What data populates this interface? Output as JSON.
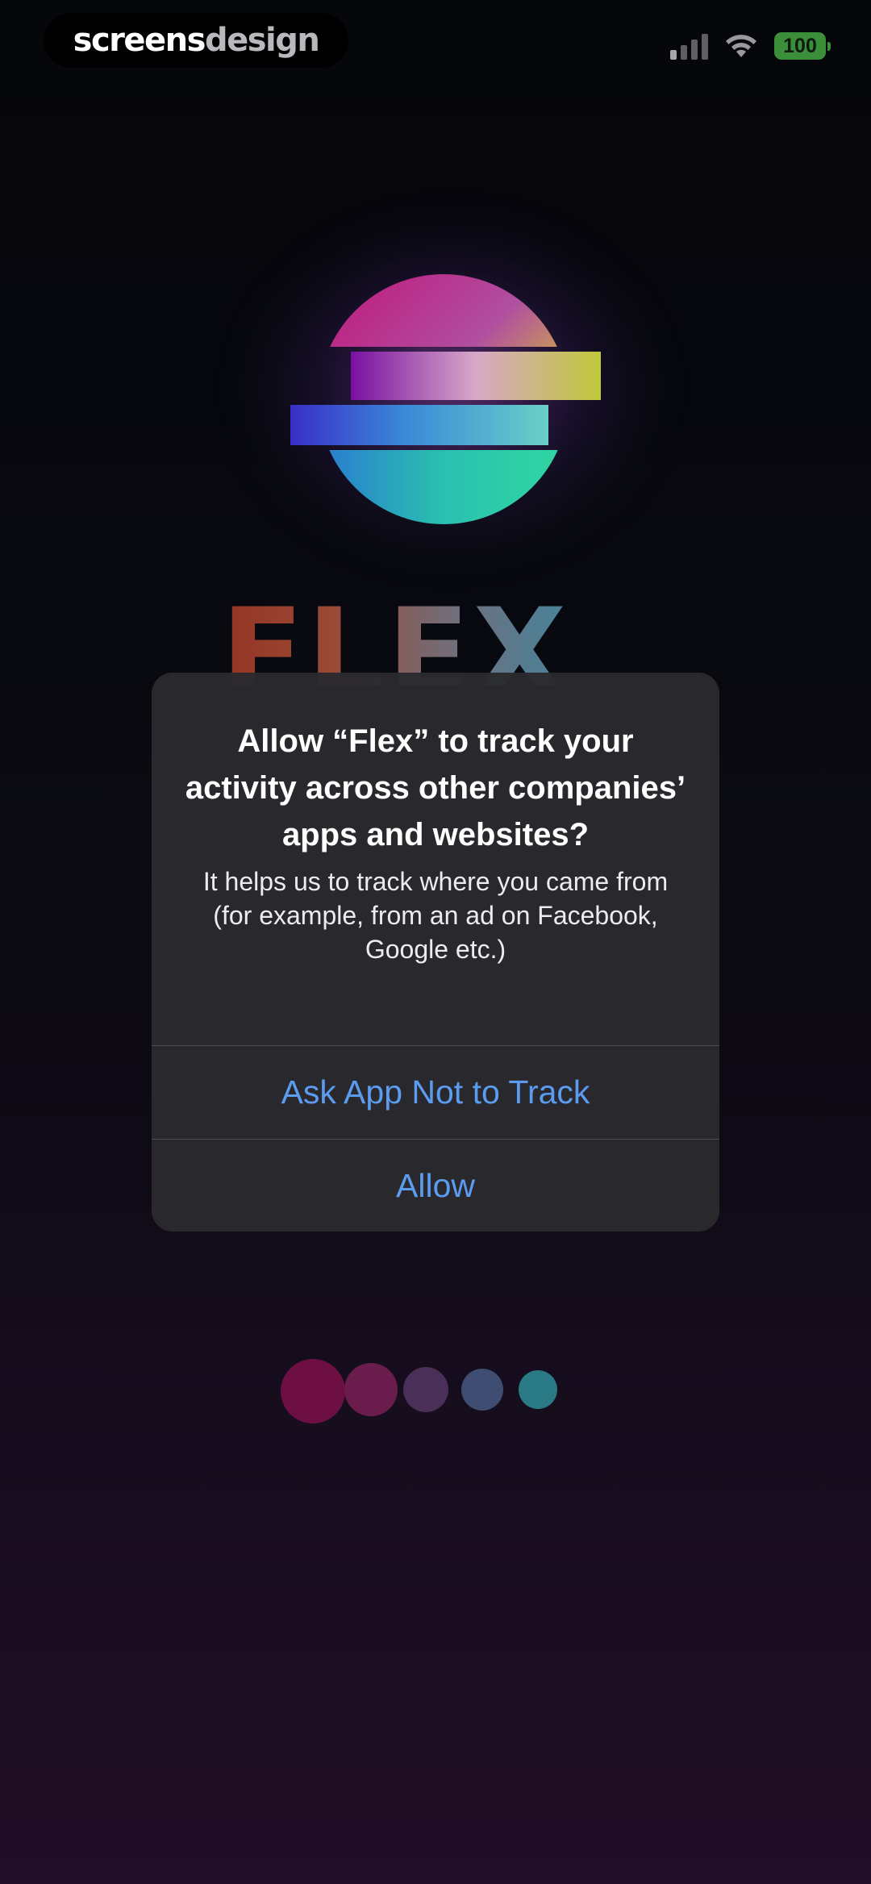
{
  "watermark": {
    "part1": "screens",
    "part2": "design"
  },
  "status_bar": {
    "battery": "100"
  },
  "brand": {
    "wordmark": "FLEX"
  },
  "alert": {
    "title": "Allow “Flex” to track your activity across other companies’ apps and websites?",
    "message": "It helps us to track where you came from (for example, from an ad on Facebook, Google etc.)",
    "buttons": [
      {
        "label": "Ask App Not to Track"
      },
      {
        "label": "Allow"
      }
    ]
  },
  "pager": {
    "dot_colors": [
      "#6e0f44",
      "#6a1d4c",
      "#4a2f58",
      "#3f4d72",
      "#2a7a86"
    ],
    "active_index": 0
  }
}
